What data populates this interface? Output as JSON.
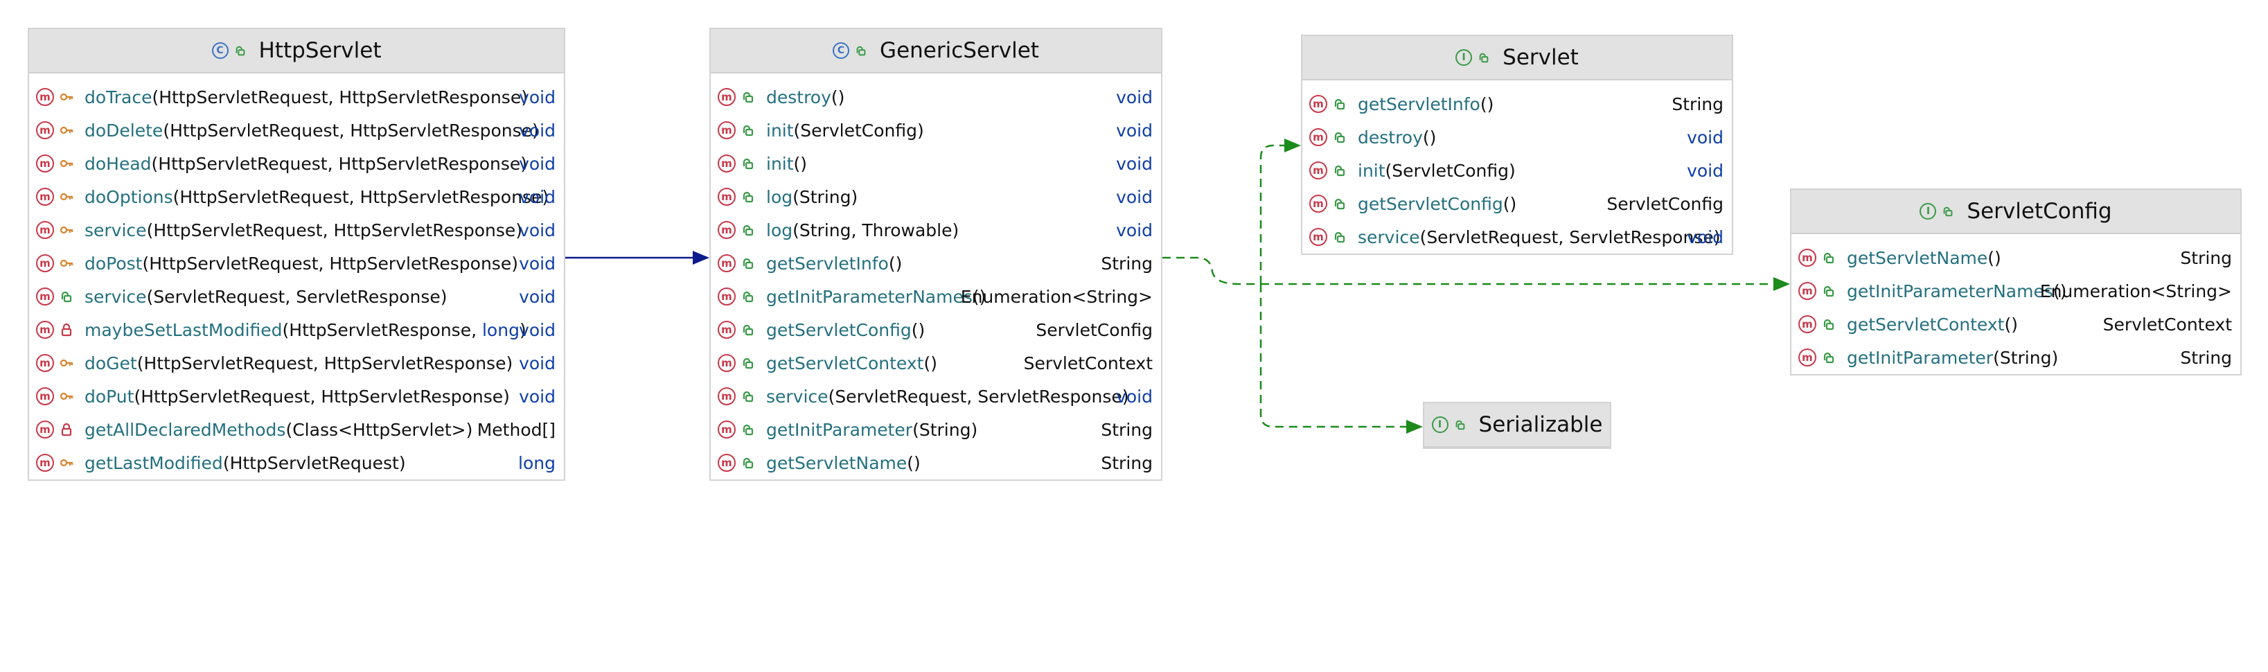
{
  "diagram": {
    "colors": {
      "extends_arrow": "#0b1a8c",
      "implements_arrow": "#1c8a1c",
      "method_icon": "#c8394a",
      "class_icon": "#3b73c5",
      "interface_icon": "#3a9a47",
      "method_name": "#24707f",
      "keyword": "#0f3fa8"
    },
    "classes": [
      {
        "id": "HttpServlet",
        "kind": "class",
        "kind_glyph": "C",
        "name": "HttpServlet",
        "methods": [
          {
            "name": "doTrace",
            "params": "(HttpServletRequest, HttpServletResponse)",
            "ret": "void",
            "ret_kw": true,
            "vis": "protected"
          },
          {
            "name": "doDelete",
            "params": "(HttpServletRequest, HttpServletResponse)",
            "ret": "void",
            "ret_kw": true,
            "vis": "protected"
          },
          {
            "name": "doHead",
            "params": "(HttpServletRequest, HttpServletResponse)",
            "ret": "void",
            "ret_kw": true,
            "vis": "protected"
          },
          {
            "name": "doOptions",
            "params": "(HttpServletRequest, HttpServletResponse)",
            "ret": "void",
            "ret_kw": true,
            "vis": "protected"
          },
          {
            "name": "service",
            "params": "(HttpServletRequest, HttpServletResponse)",
            "ret": "void",
            "ret_kw": true,
            "vis": "protected"
          },
          {
            "name": "doPost",
            "params": "(HttpServletRequest, HttpServletResponse)",
            "ret": "void",
            "ret_kw": true,
            "vis": "protected"
          },
          {
            "name": "service",
            "params": "(ServletRequest, ServletResponse)",
            "ret": "void",
            "ret_kw": true,
            "vis": "public"
          },
          {
            "name": "maybeSetLastModified",
            "params": "(HttpServletResponse, ",
            "params_kw": "long",
            "params_end": ")",
            "ret": "void",
            "ret_kw": true,
            "vis": "private"
          },
          {
            "name": "doGet",
            "params": "(HttpServletRequest, HttpServletResponse)",
            "ret": "void",
            "ret_kw": true,
            "vis": "protected"
          },
          {
            "name": "doPut",
            "params": "(HttpServletRequest, HttpServletResponse)",
            "ret": "void",
            "ret_kw": true,
            "vis": "protected"
          },
          {
            "name": "getAllDeclaredMethods",
            "params": "(Class<HttpServlet>)",
            "ret": "Method[]",
            "ret_kw": false,
            "vis": "private"
          },
          {
            "name": "getLastModified",
            "params": "(HttpServletRequest)",
            "ret": "long",
            "ret_kw": true,
            "vis": "protected"
          }
        ]
      },
      {
        "id": "GenericServlet",
        "kind": "class",
        "kind_glyph": "C",
        "name": "GenericServlet",
        "methods": [
          {
            "name": "destroy",
            "params": "()",
            "ret": "void",
            "ret_kw": true,
            "vis": "public"
          },
          {
            "name": "init",
            "params": "(ServletConfig)",
            "ret": "void",
            "ret_kw": true,
            "vis": "public"
          },
          {
            "name": "init",
            "params": "()",
            "ret": "void",
            "ret_kw": true,
            "vis": "public"
          },
          {
            "name": "log",
            "params": "(String)",
            "ret": "void",
            "ret_kw": true,
            "vis": "public"
          },
          {
            "name": "log",
            "params": "(String, Throwable)",
            "ret": "void",
            "ret_kw": true,
            "vis": "public"
          },
          {
            "name": "getServletInfo",
            "params": "()",
            "ret": "String",
            "ret_kw": false,
            "vis": "public"
          },
          {
            "name": "getInitParameterNames",
            "params": "()",
            "ret": "Enumeration<String>",
            "ret_kw": false,
            "vis": "public"
          },
          {
            "name": "getServletConfig",
            "params": "()",
            "ret": "ServletConfig",
            "ret_kw": false,
            "vis": "public"
          },
          {
            "name": "getServletContext",
            "params": "()",
            "ret": "ServletContext",
            "ret_kw": false,
            "vis": "public"
          },
          {
            "name": "service",
            "params": "(ServletRequest, ServletResponse)",
            "ret": "void",
            "ret_kw": true,
            "vis": "public"
          },
          {
            "name": "getInitParameter",
            "params": "(String)",
            "ret": "String",
            "ret_kw": false,
            "vis": "public"
          },
          {
            "name": "getServletName",
            "params": "()",
            "ret": "String",
            "ret_kw": false,
            "vis": "public"
          }
        ]
      },
      {
        "id": "Servlet",
        "kind": "interface",
        "kind_glyph": "I",
        "name": "Servlet",
        "methods": [
          {
            "name": "getServletInfo",
            "params": "()",
            "ret": "String",
            "ret_kw": false,
            "vis": "public"
          },
          {
            "name": "destroy",
            "params": "()",
            "ret": "void",
            "ret_kw": true,
            "vis": "public"
          },
          {
            "name": "init",
            "params": "(ServletConfig)",
            "ret": "void",
            "ret_kw": true,
            "vis": "public"
          },
          {
            "name": "getServletConfig",
            "params": "()",
            "ret": "ServletConfig",
            "ret_kw": false,
            "vis": "public"
          },
          {
            "name": "service",
            "params": "(ServletRequest, ServletResponse)",
            "ret": "void",
            "ret_kw": true,
            "vis": "public"
          }
        ]
      },
      {
        "id": "ServletConfig",
        "kind": "interface",
        "kind_glyph": "I",
        "name": "ServletConfig",
        "methods": [
          {
            "name": "getServletName",
            "params": "()",
            "ret": "String",
            "ret_kw": false,
            "vis": "public"
          },
          {
            "name": "getInitParameterNames",
            "params": "()",
            "ret": "Enumeration<String>",
            "ret_kw": false,
            "vis": "public"
          },
          {
            "name": "getServletContext",
            "params": "()",
            "ret": "ServletContext",
            "ret_kw": false,
            "vis": "public"
          },
          {
            "name": "getInitParameter",
            "params": "(String)",
            "ret": "String",
            "ret_kw": false,
            "vis": "public"
          }
        ]
      },
      {
        "id": "Serializable",
        "kind": "interface",
        "kind_glyph": "I",
        "name": "Serializable",
        "methods": []
      }
    ],
    "relations": [
      {
        "from": "HttpServlet",
        "to": "GenericServlet",
        "type": "extends"
      },
      {
        "from": "GenericServlet",
        "to": "Servlet",
        "type": "implements"
      },
      {
        "from": "GenericServlet",
        "to": "ServletConfig",
        "type": "implements"
      },
      {
        "from": "GenericServlet",
        "to": "Serializable",
        "type": "implements"
      }
    ]
  }
}
